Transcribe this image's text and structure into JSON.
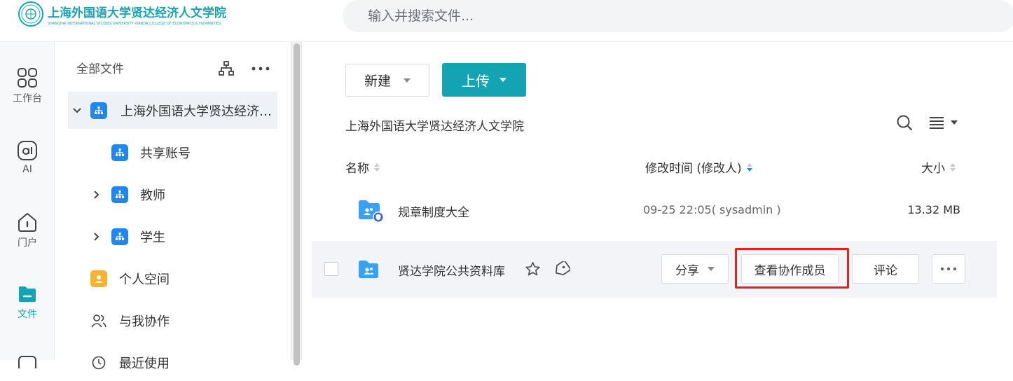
{
  "header": {
    "logo_cn": "上海外国语大学贤达经济人文学院",
    "logo_en": "SHANGHAI INTERNATIONAL STUDIES UNIVERSITY XIANDA COLLEGE OF ECONOMICS & HUMANITIES",
    "search_placeholder": "输入并搜索文件..."
  },
  "rail": {
    "items": [
      {
        "label": "工作台",
        "icon": "grid-icon"
      },
      {
        "label": "AI",
        "icon": "ai-icon"
      },
      {
        "label": "门户",
        "icon": "home-icon"
      },
      {
        "label": "文件",
        "icon": "folder-icon",
        "active": true
      }
    ]
  },
  "tree": {
    "title": "全部文件",
    "items": [
      {
        "label": "上海外国语大学贤达经济人文学院",
        "icon": "org-icon",
        "expanded": true,
        "selected": true
      },
      {
        "label": "共享账号",
        "icon": "org-icon"
      },
      {
        "label": "教师",
        "icon": "org-icon",
        "expanded": false
      },
      {
        "label": "学生",
        "icon": "org-icon",
        "expanded": false
      },
      {
        "label": "个人空间",
        "icon": "person-icon"
      },
      {
        "label": "与我协作",
        "icon": "users-icon"
      },
      {
        "label": "最近使用",
        "icon": "clock-icon"
      }
    ]
  },
  "toolbar": {
    "new_label": "新建",
    "upload_label": "上传"
  },
  "breadcrumb": "上海外国语大学贤达经济人文学院",
  "columns": {
    "name": "名称",
    "modified": "修改时间 (修改人)",
    "size": "大小"
  },
  "files": [
    {
      "name": "规章制度大全",
      "modified": "09-25 22:05( sysadmin )",
      "size": "13.32 MB"
    },
    {
      "name": "贤达学院公共资料库"
    }
  ],
  "row_actions": {
    "share": "分享",
    "view_members": "查看协作成员",
    "comment": "评论"
  },
  "colors": {
    "accent": "#14a3b2",
    "org_blue": "#1e88f0",
    "folder_blue": "#3aa0f2",
    "highlight_red": "#e41f1f"
  }
}
